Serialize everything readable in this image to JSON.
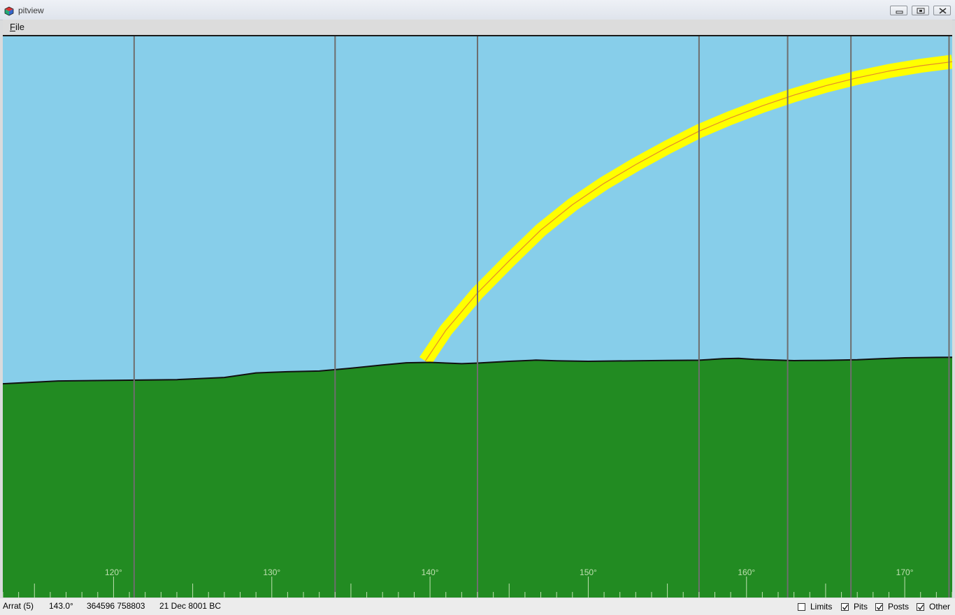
{
  "window": {
    "title": "pitview",
    "icon": "cube-app-icon",
    "controls": [
      "minimize-icon",
      "maximize-icon",
      "close-icon"
    ]
  },
  "menu": {
    "file_mnemonic": "F",
    "file_rest": "ile"
  },
  "view": {
    "colors": {
      "sky": "#87ceea",
      "ground": "#228b22",
      "horizon_line": "#111111",
      "sun_band": "#ffff00",
      "sun_path": "#e58a2a",
      "post_lines": "#6e6e6e",
      "scale_text": "#bfe0b0"
    },
    "azimuth_labels": [
      "120°",
      "130°",
      "140°",
      "150°",
      "160°",
      "170°"
    ],
    "azimuth_values": [
      120,
      130,
      140,
      150,
      160,
      170
    ],
    "azimuth_range": [
      113,
      173
    ],
    "post_azimuths": [
      121.3,
      134,
      143,
      157,
      162.6,
      166.6,
      172.8
    ],
    "horizon_profile": [
      [
        113,
        0.0
      ],
      [
        116.5,
        0.21
      ],
      [
        120,
        0.25
      ],
      [
        124,
        0.31
      ],
      [
        127,
        0.47
      ],
      [
        129,
        0.81
      ],
      [
        131,
        0.9
      ],
      [
        133,
        0.95
      ],
      [
        135,
        1.16
      ],
      [
        137,
        1.4
      ],
      [
        138.5,
        1.57
      ],
      [
        140,
        1.6
      ],
      [
        142,
        1.5
      ],
      [
        143,
        1.55
      ],
      [
        145,
        1.68
      ],
      [
        146.7,
        1.77
      ],
      [
        148,
        1.72
      ],
      [
        150,
        1.68
      ],
      [
        153,
        1.72
      ],
      [
        155,
        1.74
      ],
      [
        157,
        1.76
      ],
      [
        158.5,
        1.87
      ],
      [
        159.5,
        1.9
      ],
      [
        160.5,
        1.82
      ],
      [
        163,
        1.73
      ],
      [
        165,
        1.75
      ],
      [
        167,
        1.8
      ],
      [
        168.5,
        1.88
      ],
      [
        170,
        1.94
      ],
      [
        172,
        1.97
      ],
      [
        173,
        1.98
      ]
    ],
    "sun_path": [
      [
        139.7,
        1.7
      ],
      [
        141,
        4.0
      ],
      [
        143,
        6.8
      ],
      [
        145,
        9.2
      ],
      [
        147,
        11.5
      ],
      [
        149,
        13.4
      ],
      [
        151,
        15.0
      ],
      [
        153,
        16.4
      ],
      [
        155,
        17.7
      ],
      [
        157,
        18.9
      ],
      [
        159,
        19.9
      ],
      [
        161,
        20.8
      ],
      [
        163,
        21.6
      ],
      [
        165,
        22.3
      ],
      [
        167,
        22.9
      ],
      [
        169,
        23.4
      ],
      [
        171,
        23.8
      ],
      [
        173,
        24.1
      ]
    ],
    "elevation_range": [
      -16,
      26
    ]
  },
  "status": {
    "site": "Arrat (5)",
    "azimuth": "143.0°",
    "grid_ref": "364596 758803",
    "date": "21 Dec 8001 BC",
    "checkboxes": [
      {
        "label": "Limits",
        "checked": false
      },
      {
        "label": "Pits",
        "checked": true
      },
      {
        "label": "Posts",
        "checked": true
      },
      {
        "label": "Other",
        "checked": true
      }
    ]
  }
}
